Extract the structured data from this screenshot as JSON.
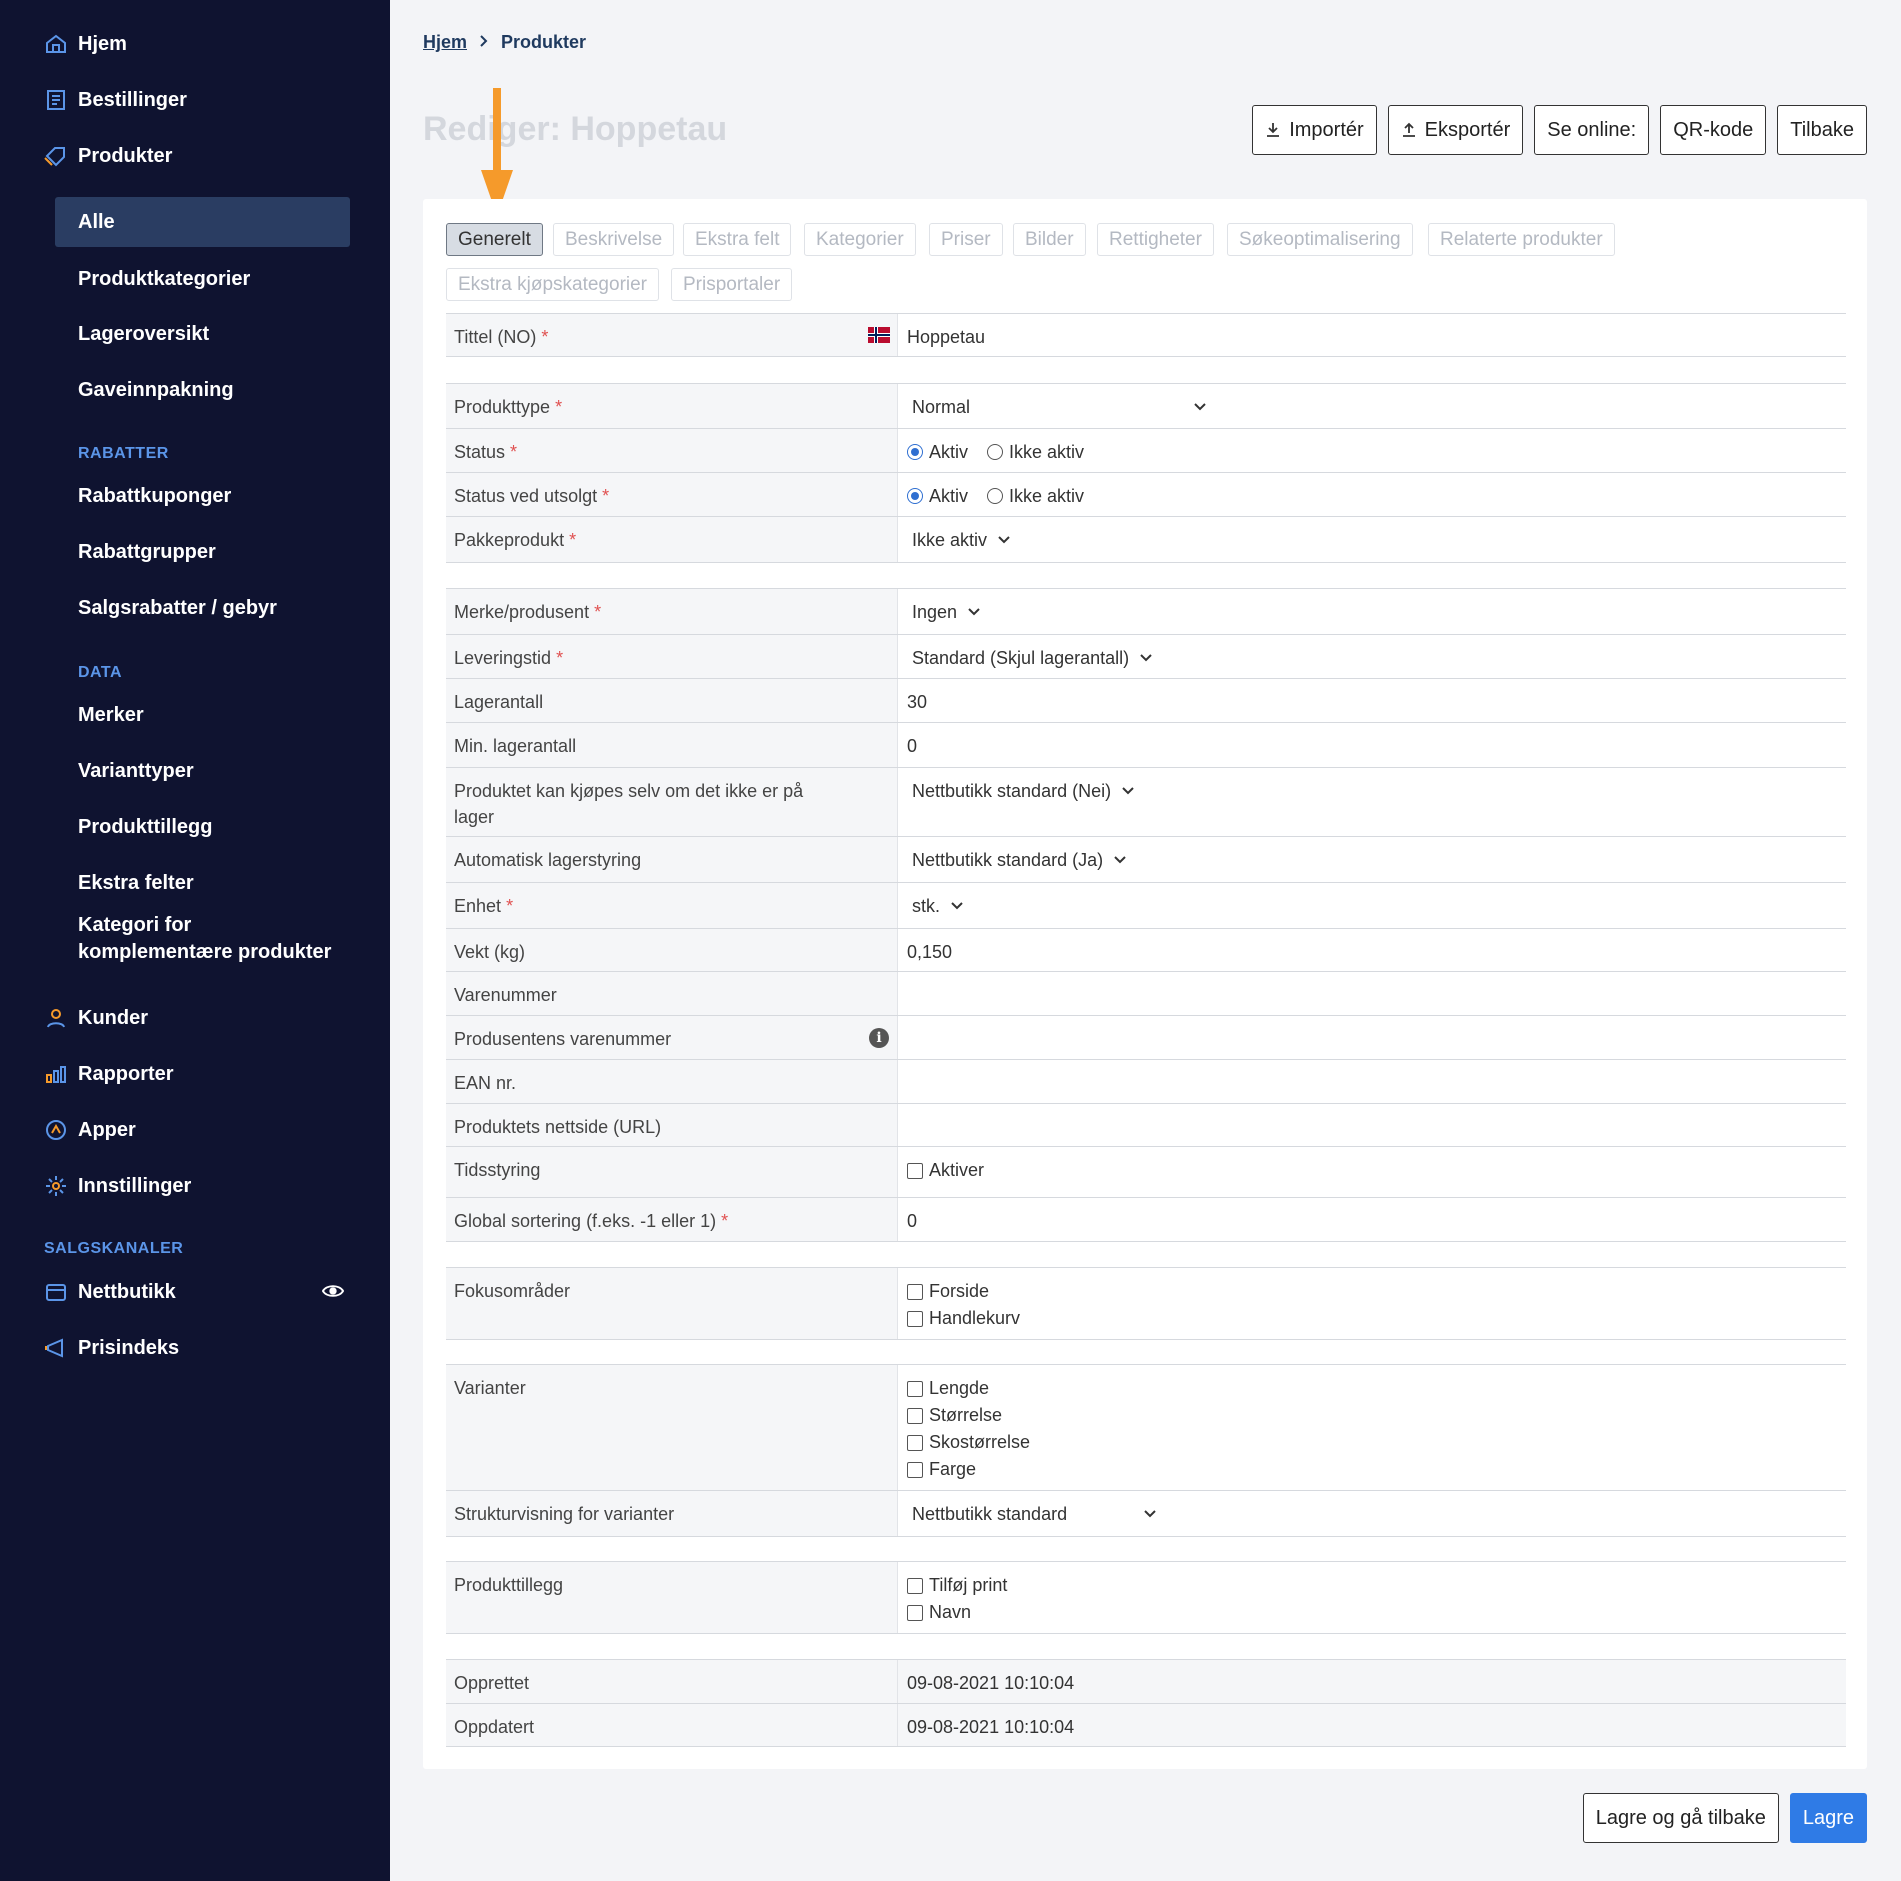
{
  "sidebar": {
    "main_items": [
      {
        "label": "Hjem",
        "icon": "home-icon"
      },
      {
        "label": "Bestillinger",
        "icon": "orders-icon"
      },
      {
        "label": "Produkter",
        "icon": "tag-icon"
      }
    ],
    "product_sub_items": [
      "Alle",
      "Produktkategorier",
      "Lageroversikt",
      "Gaveinnpakning"
    ],
    "rabatter_label": "RABATTER",
    "rabatter_items": [
      "Rabattkuponger",
      "Rabattgrupper",
      "Salgsrabatter / gebyr"
    ],
    "data_label": "DATA",
    "data_items": [
      "Merker",
      "Varianttyper",
      "Produkttillegg",
      "Ekstra felter",
      "Kategori for",
      "komplementære produkter"
    ],
    "lower_items": [
      {
        "label": "Kunder",
        "icon": "user-icon"
      },
      {
        "label": "Rapporter",
        "icon": "bar-chart-icon"
      },
      {
        "label": "Apper",
        "icon": "apps-icon"
      },
      {
        "label": "Innstillinger",
        "icon": "gear-icon"
      }
    ],
    "salgskanaler_label": "SALGSKANALER",
    "channel_items": [
      {
        "label": "Nettbutikk",
        "icon": "store-icon"
      },
      {
        "label": "Prisindeks",
        "icon": "megaphone-icon"
      }
    ]
  },
  "breadcrumb": {
    "home": "Hjem",
    "current": "Produkter"
  },
  "page_title": "Rediger: Hoppetau",
  "toolbar": {
    "import": "Importér",
    "export": "Eksportér",
    "online": "Se online:",
    "qr": "QR-kode",
    "back": "Tilbake"
  },
  "tabs": [
    "Generelt",
    "Beskrivelse",
    "Ekstra felt",
    "Kategorier",
    "Priser",
    "Bilder",
    "Rettigheter",
    "Søkeoptimalisering",
    "Relaterte produkter",
    "Ekstra kjøpskategorier",
    "Prisportaler"
  ],
  "form": {
    "title_label": "Tittel (NO)",
    "title_value": "Hoppetau",
    "type_label": "Produkttype",
    "type_value": "Normal",
    "status_label": "Status",
    "status_on": "Aktiv",
    "status_off": "Ikke aktiv",
    "soldout_label": "Status ved utsolgt",
    "soldout_on": "Aktiv",
    "soldout_off": "Ikke aktiv",
    "package_label": "Pakkeprodukt",
    "package_value": "Ikke aktiv",
    "brand_label": "Merke/produsent",
    "brand_value": "Ingen",
    "delivery_label": "Leveringstid",
    "delivery_value": "Standard (Skjul lagerantall)",
    "stock_label": "Lagerantall",
    "stock_value": "30",
    "minstock_label": "Min. lagerantall",
    "minstock_value": "0",
    "backorder_label_1": "Produktet kan kjøpes selv om det ikke er på",
    "backorder_label_2": "lager",
    "backorder_value": "Nettbutikk standard (Nei)",
    "autostock_label": "Automatisk lagerstyring",
    "autostock_value": "Nettbutikk standard (Ja)",
    "unit_label": "Enhet",
    "unit_value": "stk.",
    "weight_label": "Vekt (kg)",
    "weight_value": "0,150",
    "sku_label": "Varenummer",
    "mfr_sku_label": "Produsentens varenummer",
    "ean_label": "EAN nr.",
    "url_label": "Produktets nettside (URL)",
    "timing_label": "Tidsstyring",
    "timing_value": "Aktiver",
    "sort_label": "Global sortering (f.eks. -1 eller 1)",
    "sort_value": "0",
    "focus_label": "Fokusområder",
    "focus_options": [
      "Forside",
      "Handlekurv"
    ],
    "variants_label": "Varianter",
    "variant_options": [
      "Lengde",
      "Størrelse",
      "Skostørrelse",
      "Farge"
    ],
    "structure_label": "Strukturvisning for varianter",
    "structure_value": "Nettbutikk standard",
    "addons_label": "Produkttillegg",
    "addon_options": [
      "Tilføj print",
      "Navn"
    ],
    "created_label": "Opprettet",
    "created_value": "09-08-2021 10:10:04",
    "updated_label": "Oppdatert",
    "updated_value": "09-08-2021 10:10:04"
  },
  "footer": {
    "save_back": "Lagre og gå tilbake",
    "save": "Lagre"
  },
  "colors": {
    "sidebar_bg": "#0f1330",
    "accent": "#2f7be6",
    "arrow": "#f59a2b"
  }
}
